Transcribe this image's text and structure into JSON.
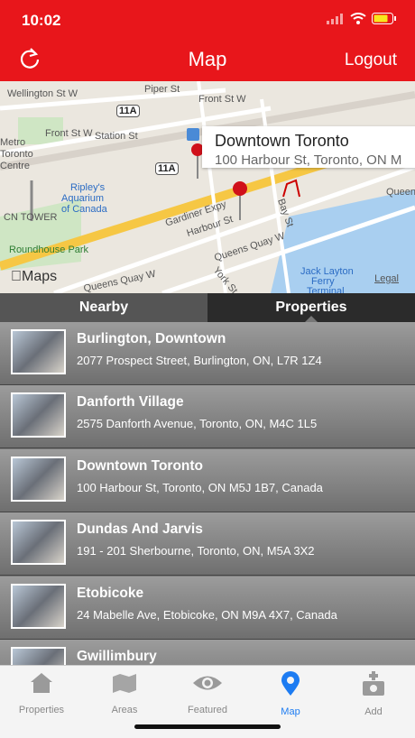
{
  "status": {
    "time": "10:02"
  },
  "nav": {
    "title": "Map",
    "right": "Logout"
  },
  "map": {
    "labels": {
      "wellington": "Wellington St W",
      "piper": "Piper St",
      "frontW1": "Front St W",
      "frontW2": "Front St W",
      "station": "Station St",
      "metroCentre": "Metro",
      "metroCentre2": "Toronto",
      "metroCentre3": "Centre",
      "ripleys": "Ripley's",
      "ripleys2": "Aquarium",
      "ripleys3": "of Canada",
      "cnTower": "CN TOWER",
      "gardiner": "Gardiner Expy",
      "harbour": "Harbour St",
      "bay": "Bay St",
      "queensQuay1": "Queens Quay W",
      "queensQuay2": "Queens Quay W",
      "queens": "Queens",
      "roundhouse": "Roundhouse Park",
      "jackLayton": "Jack Layton",
      "jackLayton2": "Ferry",
      "jackLayton3": "Terminal",
      "hwy1": "11A",
      "hwy2": "11A",
      "york": "York St"
    },
    "callout": {
      "title": "Downtown Toronto",
      "subtitle": "100 Harbour St, Toronto, ON M"
    },
    "attribution": "Maps",
    "legal": "Legal"
  },
  "tabs": {
    "nearby": "Nearby",
    "properties": "Properties"
  },
  "properties": [
    {
      "name": "Burlington, Downtown",
      "address": "2077 Prospect Street, Burlington, ON, L7R 1Z4"
    },
    {
      "name": "Danforth Village",
      "address": "2575 Danforth Avenue, Toronto, ON, M4C 1L5"
    },
    {
      "name": "Downtown Toronto",
      "address": "100 Harbour St, Toronto, ON M5J 1B7, Canada"
    },
    {
      "name": "Dundas And Jarvis",
      "address": "191 - 201 Sherbourne, Toronto, ON, M5A 3X2"
    },
    {
      "name": "Etobicoke",
      "address": "24 Mabelle Ave, Etobicoke, ON M9A 4X7, Canada"
    },
    {
      "name": "Gwillimbury",
      "address": ""
    }
  ],
  "tabbar": [
    {
      "label": "Properties",
      "icon": "house-icon"
    },
    {
      "label": "Areas",
      "icon": "map-area-icon"
    },
    {
      "label": "Featured",
      "icon": "eye-icon"
    },
    {
      "label": "Map",
      "icon": "map-pin-icon"
    },
    {
      "label": "Add",
      "icon": "add-camera-icon"
    }
  ],
  "colors": {
    "header": "#e8161b",
    "active": "#1d7cf2"
  }
}
